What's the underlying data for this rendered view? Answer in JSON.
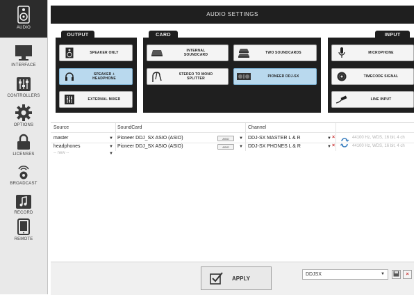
{
  "sidebar": {
    "items": [
      {
        "label": "AUDIO",
        "icon": "speaker-icon",
        "active": true
      },
      {
        "label": "INTERFACE",
        "icon": "monitor-icon",
        "active": false
      },
      {
        "label": "CONTROLLERS",
        "icon": "sliders-icon",
        "active": false
      },
      {
        "label": "OPTIONS",
        "icon": "gear-icon",
        "active": false
      },
      {
        "label": "LICENSES",
        "icon": "lock-icon",
        "active": false
      },
      {
        "label": "BROADCAST",
        "icon": "broadcast-icon",
        "active": false
      },
      {
        "label": "RECORD",
        "icon": "music-note-icon",
        "active": false
      },
      {
        "label": "REMOTE",
        "icon": "tablet-icon",
        "active": false
      }
    ]
  },
  "title": "AUDIO SETTINGS",
  "output": {
    "tab": "OUTPUT",
    "options": [
      {
        "label": "SPEAKER ONLY",
        "icon": "speaker-icon"
      },
      {
        "label": "SPEAKER +\nHEADPHONE",
        "icon": "headphone-icon"
      },
      {
        "label": "EXTERNAL MIXER",
        "icon": "mixer-icon"
      }
    ]
  },
  "card": {
    "tab": "CARD",
    "options": [
      {
        "label": "INTERNAL\nSOUNDCARD",
        "icon": "soundcard-icon"
      },
      {
        "label": "TWO SOUNDCARDS",
        "icon": "two-soundcards-icon"
      },
      {
        "label": "STEREO TO MONO\nSPLITTER",
        "icon": "splitter-cable-icon"
      },
      {
        "label": "PIONEER DDJ-SX",
        "icon": "controller-icon"
      }
    ]
  },
  "input": {
    "tab": "INPUT",
    "options": [
      {
        "label": "MICROPHONE",
        "icon": "microphone-icon"
      },
      {
        "label": "TIMECODE SIGNAL",
        "icon": "vinyl-icon"
      },
      {
        "label": "LINE INPUT",
        "icon": "line-cable-icon"
      }
    ]
  },
  "table": {
    "headers": {
      "source": "Source",
      "soundcard": "SoundCard",
      "channel": "Channel"
    },
    "rows": [
      {
        "source": "master",
        "soundcard": "Pioneer DDJ_SX ASIO (ASIO)",
        "asio": "ASIO",
        "channel": "DDJ-SX MASTER L & R",
        "format": "44100 Hz, WDS, 16 bit, 4 ch"
      },
      {
        "source": "headphones",
        "soundcard": "Pioneer DDJ_SX ASIO (ASIO)",
        "asio": "ASIO",
        "channel": "DDJ-SX PHONES L & R",
        "format": "44100 Hz, WDS, 16 bit, 4 ch"
      }
    ],
    "new_row": "-- new --"
  },
  "bottom": {
    "apply": "APPLY",
    "config_value": "DDJSX"
  },
  "colors": {
    "panel": "#1f1f1f",
    "selected_option": "#b9d9ee",
    "delete": "#c62828"
  }
}
